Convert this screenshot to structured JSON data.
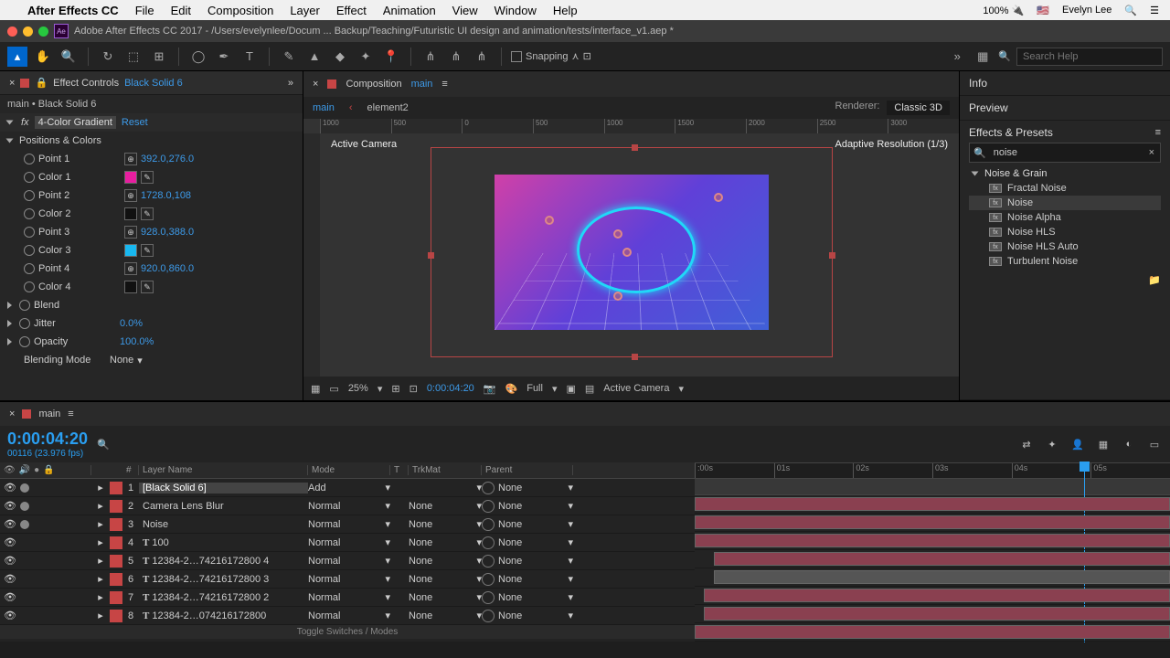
{
  "menubar": {
    "apple": "",
    "app": "After Effects CC",
    "items": [
      "File",
      "Edit",
      "Composition",
      "Layer",
      "Effect",
      "Animation",
      "View",
      "Window",
      "Help"
    ],
    "battery": "100%",
    "user": "Evelyn Lee"
  },
  "titlebar": {
    "ae": "Ae",
    "title": "Adobe After Effects CC 2017 - /Users/evelynlee/Docum ... Backup/Teaching/Futuristic UI design and animation/tests/interface_v1.aep *"
  },
  "toolbar": {
    "snapping": "Snapping",
    "search_ph": "Search Help"
  },
  "effectControls": {
    "tab_prefix": "Effect Controls",
    "tab_layer": "Black Solid 6",
    "breadcrumb": "main • Black Solid 6",
    "effect_name": "4-Color Gradient",
    "reset": "Reset",
    "group": "Positions & Colors",
    "rows": [
      {
        "name": "Point 1",
        "val": "392.0,276.0"
      },
      {
        "name": "Color 1",
        "color": "#e81ea0"
      },
      {
        "name": "Point 2",
        "val": "1728.0,108"
      },
      {
        "name": "Color 2",
        "color": "#111"
      },
      {
        "name": "Point 3",
        "val": "928.0,388.0"
      },
      {
        "name": "Color 3",
        "color": "#18b8f0"
      },
      {
        "name": "Point 4",
        "val": "920.0,860.0"
      },
      {
        "name": "Color 4",
        "color": "#111"
      }
    ],
    "blend": {
      "name": "Blend"
    },
    "jitter": {
      "name": "Jitter",
      "val": "0.0%"
    },
    "opacity": {
      "name": "Opacity",
      "val": "100.0%"
    },
    "blending_mode": {
      "name": "Blending Mode",
      "val": "None"
    }
  },
  "composition": {
    "label": "Composition",
    "name": "main",
    "tabs": [
      "main",
      "element2"
    ],
    "renderer_label": "Renderer:",
    "renderer_value": "Classic 3D",
    "overlay_left": "Active Camera",
    "overlay_right": "Adaptive Resolution (1/3)",
    "ruler_marks": [
      "1000",
      "500",
      "0",
      "500",
      "1000",
      "1500",
      "2000",
      "2500",
      "3000"
    ]
  },
  "viewerFooter": {
    "zoom": "25%",
    "timecode": "0:00:04:20",
    "res": "Full",
    "camera": "Active Camera"
  },
  "rightPanel": {
    "info": "Info",
    "preview": "Preview",
    "effects_presets": "Effects & Presets",
    "search_value": "noise",
    "category": "Noise & Grain",
    "items": [
      {
        "label": "Fractal Noise",
        "sel": false
      },
      {
        "label": "Noise",
        "sel": true
      },
      {
        "label": "Noise Alpha",
        "sel": false
      },
      {
        "label": "Noise HLS",
        "sel": false
      },
      {
        "label": "Noise HLS Auto",
        "sel": false
      },
      {
        "label": "Turbulent Noise",
        "sel": false
      }
    ]
  },
  "timeline": {
    "tab": "main",
    "timecode": "0:00:04:20",
    "frames": "00116 (23.976 fps)",
    "ruler": [
      ":00s",
      "01s",
      "02s",
      "03s",
      "04s",
      "05s"
    ],
    "cols": {
      "layer_name": "Layer Name",
      "mode": "Mode",
      "trkmat": "TrkMat",
      "parent": "Parent",
      "num": "#"
    },
    "layers": [
      {
        "n": 1,
        "name": "[Black Solid 6]",
        "mode": "Add",
        "trk": "",
        "parent": "None",
        "sel": true,
        "color": "#c74545",
        "bar": [
          0,
          100
        ],
        "bcolor": "#8a4050"
      },
      {
        "n": 2,
        "name": "Camera Lens Blur",
        "mode": "Normal",
        "trk": "None",
        "parent": "None",
        "sel": false,
        "color": "#c74545",
        "bar": [
          0,
          100
        ],
        "bcolor": "#8a4050"
      },
      {
        "n": 3,
        "name": "Noise",
        "mode": "Normal",
        "trk": "None",
        "parent": "None",
        "sel": false,
        "color": "#c74545",
        "bar": [
          0,
          100
        ],
        "bcolor": "#8a4050"
      },
      {
        "n": 4,
        "name": "100",
        "mode": "Normal",
        "trk": "None",
        "parent": "None",
        "sel": false,
        "color": "#c74545",
        "t": "T",
        "bar": [
          4,
          100
        ],
        "bcolor": "#8a4050"
      },
      {
        "n": 5,
        "name": "12384-2…74216172800 4",
        "mode": "Normal",
        "trk": "None",
        "parent": "None",
        "sel": false,
        "color": "#c74545",
        "t": "T",
        "bar": [
          4,
          100
        ],
        "bcolor": "#555"
      },
      {
        "n": 6,
        "name": "12384-2…74216172800 3",
        "mode": "Normal",
        "trk": "None",
        "parent": "None",
        "sel": false,
        "color": "#c74545",
        "t": "T",
        "bar": [
          2,
          100
        ],
        "bcolor": "#8a4050"
      },
      {
        "n": 7,
        "name": "12384-2…74216172800 2",
        "mode": "Normal",
        "trk": "None",
        "parent": "None",
        "sel": false,
        "color": "#c74545",
        "t": "T",
        "bar": [
          2,
          100
        ],
        "bcolor": "#8a4050"
      },
      {
        "n": 8,
        "name": "12384-2…074216172800",
        "mode": "Normal",
        "trk": "None",
        "parent": "None",
        "sel": false,
        "color": "#c74545",
        "t": "T",
        "bar": [
          0,
          100
        ],
        "bcolor": "#8a4050"
      }
    ],
    "toggle": "Toggle Switches / Modes"
  }
}
